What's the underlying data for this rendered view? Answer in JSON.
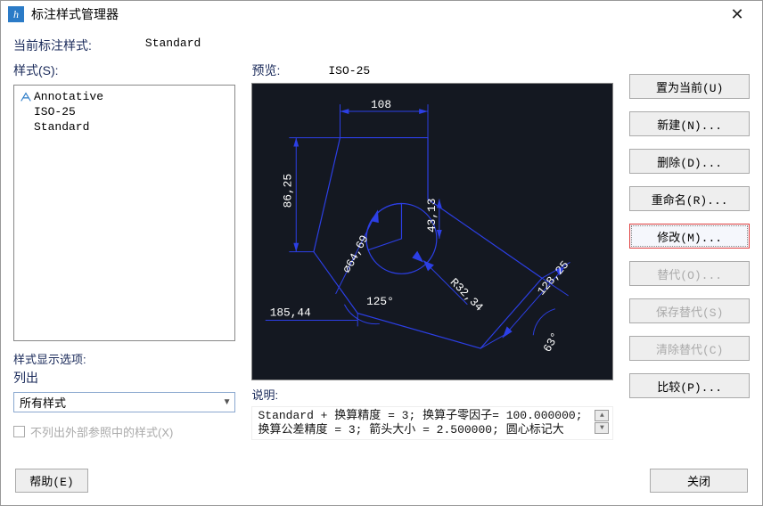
{
  "window": {
    "title": "标注样式管理器"
  },
  "current": {
    "label": "当前标注样式:",
    "value": "Standard"
  },
  "styles": {
    "label": "样式(S):",
    "items": [
      {
        "name": "Annotative",
        "has_icon": true
      },
      {
        "name": "ISO-25",
        "has_icon": false
      },
      {
        "name": "Standard",
        "has_icon": false
      }
    ]
  },
  "display_option": {
    "label": "样式显示选项:",
    "sublabel": "列出"
  },
  "filter": {
    "value": "所有样式"
  },
  "no_xref": {
    "label": "不列出外部参照中的样式(X)",
    "checked": false
  },
  "preview": {
    "label": "预览:",
    "name": "ISO-25"
  },
  "preview_dims": {
    "width": "108",
    "height": "86,25",
    "radius": "R32,34",
    "diag": "⌀64,69",
    "slant_len": "128,25",
    "angle": "125°",
    "x_coord": "185,44",
    "vert_small": "43,13",
    "small_angle": "63°"
  },
  "description": {
    "label": "说明:",
    "line1": "Standard + 换算精度 = 3; 换算子零因子= 100.000000;",
    "line2": "换算公差精度 = 3; 箭头大小 = 2.500000; 圆心标记大"
  },
  "buttons": {
    "set_current": "置为当前(U)",
    "new": "新建(N)...",
    "delete": "删除(D)...",
    "rename": "重命名(R)...",
    "modify": "修改(M)...",
    "override": "替代(O)...",
    "save_override": "保存替代(S)",
    "clear_override": "清除替代(C)",
    "compare": "比较(P)...",
    "help": "帮助(E)",
    "close": "关闭"
  }
}
